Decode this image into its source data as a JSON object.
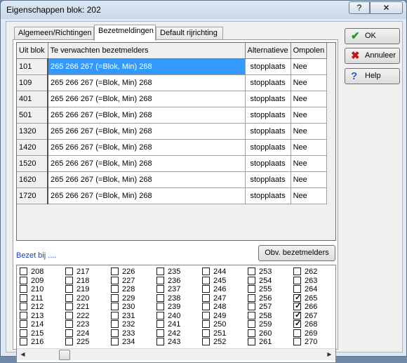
{
  "window": {
    "title": "Eigenschappen blok: 202",
    "help_glyph": "?",
    "close_glyph": "✕"
  },
  "tabs": [
    "Algemeen/Richtingen",
    "Bezetmeldingen",
    "Default rijrichting"
  ],
  "table": {
    "headers": [
      "Uit blok",
      "Te verwachten bezetmelders",
      "Alternatieve",
      "Ompolen"
    ],
    "rows": [
      {
        "blok": "101",
        "verwacht": "265  266  267 (=Blok, Min)  268",
        "alt": "stopplaats",
        "omp": "Nee"
      },
      {
        "blok": "109",
        "verwacht": "265  266  267 (=Blok, Min)  268",
        "alt": "stopplaats",
        "omp": "Nee"
      },
      {
        "blok": "401",
        "verwacht": "265  266  267 (=Blok, Min)  268",
        "alt": "stopplaats",
        "omp": "Nee"
      },
      {
        "blok": "501",
        "verwacht": "265  266  267 (=Blok, Min)  268",
        "alt": "stopplaats",
        "omp": "Nee"
      },
      {
        "blok": "1320",
        "verwacht": "265  266  267 (=Blok, Min)  268",
        "alt": "stopplaats",
        "omp": "Nee"
      },
      {
        "blok": "1420",
        "verwacht": "265  266  267 (=Blok, Min)  268",
        "alt": "stopplaats",
        "omp": "Nee"
      },
      {
        "blok": "1520",
        "verwacht": "265  266  267 (=Blok, Min)  268",
        "alt": "stopplaats",
        "omp": "Nee"
      },
      {
        "blok": "1620",
        "verwacht": "265  266  267 (=Blok, Min)  268",
        "alt": "stopplaats",
        "omp": "Nee"
      },
      {
        "blok": "1720",
        "verwacht": "265  266  267 (=Blok, Min)  268",
        "alt": "stopplaats",
        "omp": "Nee"
      }
    ]
  },
  "bezet": {
    "label": "Bezet bij ....",
    "button": "Obv. bezetmelders",
    "columns": [
      {
        "items": [
          {
            "n": "208",
            "c": false
          },
          {
            "n": "209",
            "c": false
          },
          {
            "n": "210",
            "c": false
          },
          {
            "n": "211",
            "c": false
          },
          {
            "n": "212",
            "c": false
          },
          {
            "n": "213",
            "c": false
          },
          {
            "n": "214",
            "c": false
          },
          {
            "n": "215",
            "c": false
          },
          {
            "n": "216",
            "c": false
          }
        ]
      },
      {
        "items": [
          {
            "n": "217",
            "c": false
          },
          {
            "n": "218",
            "c": false
          },
          {
            "n": "219",
            "c": false
          },
          {
            "n": "220",
            "c": false
          },
          {
            "n": "221",
            "c": false
          },
          {
            "n": "222",
            "c": false
          },
          {
            "n": "223",
            "c": false
          },
          {
            "n": "224",
            "c": false
          },
          {
            "n": "225",
            "c": false
          }
        ]
      },
      {
        "items": [
          {
            "n": "226",
            "c": false
          },
          {
            "n": "227",
            "c": false
          },
          {
            "n": "228",
            "c": false
          },
          {
            "n": "229",
            "c": false
          },
          {
            "n": "230",
            "c": false
          },
          {
            "n": "231",
            "c": false
          },
          {
            "n": "232",
            "c": false
          },
          {
            "n": "233",
            "c": false
          },
          {
            "n": "234",
            "c": false
          }
        ]
      },
      {
        "items": [
          {
            "n": "235",
            "c": false
          },
          {
            "n": "236",
            "c": false
          },
          {
            "n": "237",
            "c": false
          },
          {
            "n": "238",
            "c": false
          },
          {
            "n": "239",
            "c": false
          },
          {
            "n": "240",
            "c": false
          },
          {
            "n": "241",
            "c": false
          },
          {
            "n": "242",
            "c": false
          },
          {
            "n": "243",
            "c": false
          }
        ]
      },
      {
        "items": [
          {
            "n": "244",
            "c": false
          },
          {
            "n": "245",
            "c": false
          },
          {
            "n": "246",
            "c": false
          },
          {
            "n": "247",
            "c": false
          },
          {
            "n": "248",
            "c": false
          },
          {
            "n": "249",
            "c": false
          },
          {
            "n": "250",
            "c": false
          },
          {
            "n": "251",
            "c": false
          },
          {
            "n": "252",
            "c": false
          }
        ]
      },
      {
        "items": [
          {
            "n": "253",
            "c": false
          },
          {
            "n": "254",
            "c": false
          },
          {
            "n": "255",
            "c": false
          },
          {
            "n": "256",
            "c": false
          },
          {
            "n": "257",
            "c": false
          },
          {
            "n": "258",
            "c": false
          },
          {
            "n": "259",
            "c": false
          },
          {
            "n": "260",
            "c": false
          },
          {
            "n": "261",
            "c": false
          }
        ]
      },
      {
        "items": [
          {
            "n": "262",
            "c": false
          },
          {
            "n": "263",
            "c": false
          },
          {
            "n": "264",
            "c": false
          },
          {
            "n": "265",
            "c": true
          },
          {
            "n": "266",
            "c": true
          },
          {
            "n": "267",
            "c": true
          },
          {
            "n": "268",
            "c": true
          },
          {
            "n": "269",
            "c": false
          },
          {
            "n": "270",
            "c": false
          }
        ]
      }
    ]
  },
  "buttons": {
    "ok": {
      "label": "OK",
      "icon": "checkmark-icon",
      "color": "#1a9a1a"
    },
    "cancel": {
      "label": "Annuleer",
      "icon": "cross-icon",
      "color": "#c01818"
    },
    "help": {
      "label": "Help",
      "icon": "question-icon",
      "color": "#1f5fd6"
    }
  },
  "colors": {
    "selection": "#3399ff",
    "link_text": "#1a3fbf"
  }
}
